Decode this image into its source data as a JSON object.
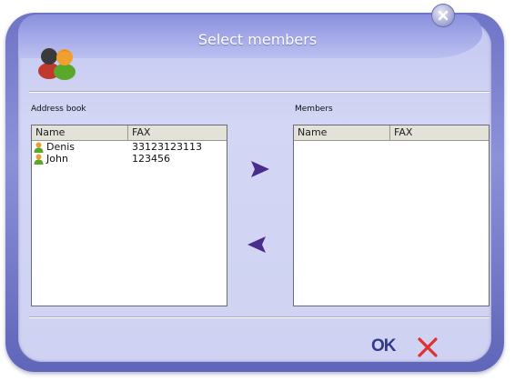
{
  "window": {
    "title": "Select members"
  },
  "address_book": {
    "label": "Address book",
    "columns": [
      "Name",
      "FAX"
    ],
    "rows": [
      {
        "name": "Denis",
        "fax": "33123123113"
      },
      {
        "name": "John",
        "fax": "123456"
      }
    ]
  },
  "members": {
    "label": "Members",
    "columns": [
      "Name",
      "FAX"
    ],
    "rows": []
  },
  "footer": {
    "ok_label": "OK"
  },
  "colors": {
    "accent": "#4a2c8c",
    "cancel": "#e03030",
    "frame": "#6f75c6"
  }
}
